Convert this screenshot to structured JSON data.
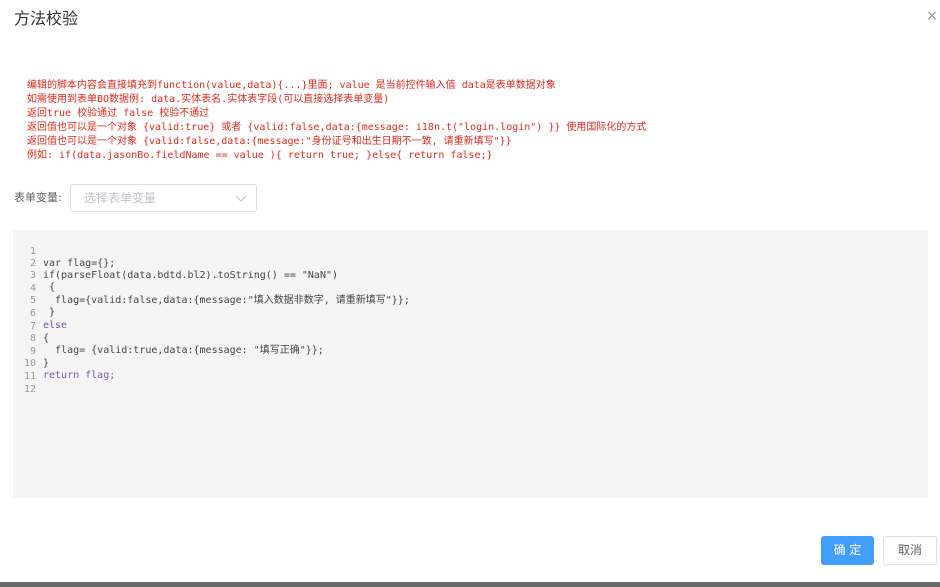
{
  "dialog": {
    "title": "方法校验",
    "close_label": "×"
  },
  "tips": [
    "编辑的脚本内容会直接填充到function(value,data){...}里面; value 是当前控件输入值 data是表单数据对象",
    "如需使用到表单BO数据例: data.实体表名.实体表字段(可以直接选择表单变量)",
    "返回true 校验通过 false 校验不通过",
    "返回值也可以是一个对象 {valid:true} 或者 {valid:false,data:{message: i18n.t(\"login.login\") }} 使用国际化的方式",
    "返回值也可以是一个对象 {valid:false,data:{message:\"身份证号和出生日期不一致, 请重新填写\"}}",
    "例如:  if(data.jasonBo.fieldName == value ){ return true; }else{ return false;}"
  ],
  "form": {
    "label": "表单变量:",
    "select_placeholder": "选择表单变量"
  },
  "editor": {
    "line_numbers": [
      "1",
      "2",
      "3",
      "4",
      "5",
      "6",
      "7",
      "8",
      "9",
      "10",
      "11",
      "12"
    ],
    "lines": [
      "var flag={};",
      "if(parseFloat(data.bdtd.bl2).toString() == \"NaN\")",
      " {",
      "  flag={valid:false,data:{message:\"填入数据非数字, 请重新填写\"}};",
      " }",
      "else",
      "{",
      "  flag= {valid:true,data:{message: \"填写正确\"}};",
      "}",
      "return flag;",
      "",
      ""
    ]
  },
  "buttons": {
    "ok_label": "确 定",
    "cancel_label": "取消"
  },
  "colors": {
    "tips_text": "#e0291f",
    "primary": "#409eff",
    "editor_bg": "#f5f5f5"
  },
  "icons": {
    "close": "close-icon",
    "chevron": "chevron-down-icon"
  }
}
